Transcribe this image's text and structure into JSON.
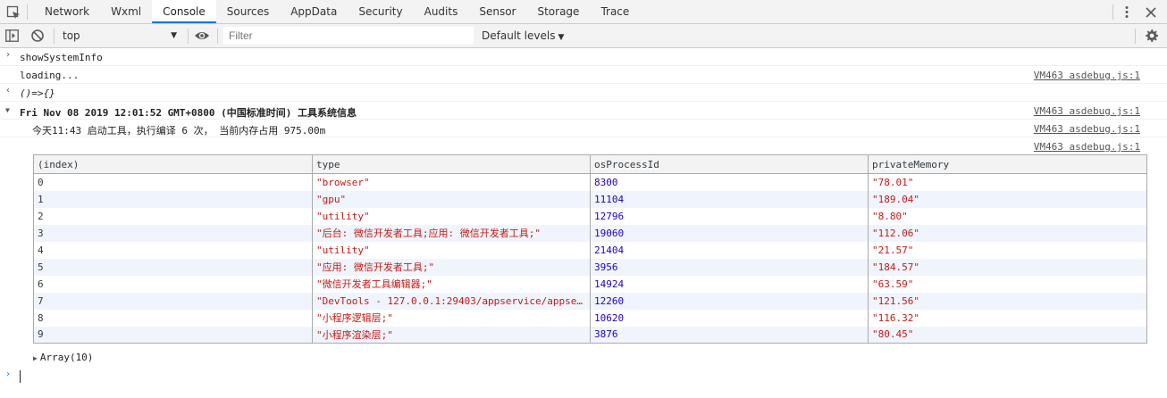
{
  "tabs": [
    {
      "label": "Network"
    },
    {
      "label": "Wxml"
    },
    {
      "label": "Console",
      "active": true
    },
    {
      "label": "Sources"
    },
    {
      "label": "AppData"
    },
    {
      "label": "Security"
    },
    {
      "label": "Audits"
    },
    {
      "label": "Sensor"
    },
    {
      "label": "Storage"
    },
    {
      "label": "Trace"
    }
  ],
  "toolbar": {
    "context": "top",
    "filter_placeholder": "Filter",
    "levels_label": "Default levels"
  },
  "console": {
    "lines": [
      {
        "prompt": ">",
        "text": "showSystemInfo",
        "source": ""
      },
      {
        "prompt": "",
        "text": "loading...",
        "source": "VM463 asdebug.js:1"
      },
      {
        "prompt": "<",
        "text": "()=>{}",
        "source": ""
      },
      {
        "prompt": "▼",
        "text": "Fri Nov 08 2019 12:01:52 GMT+0800 (中国标准时间) 工具系统信息",
        "source": "VM463 asdebug.js:1"
      },
      {
        "prompt": "",
        "text": "今天11:43 启动工具，执行编译 6 次， 当前内存占用 975.00m",
        "source": "VM463 asdebug.js:1"
      },
      {
        "prompt": "",
        "text": "",
        "source": "VM463 asdebug.js:1"
      }
    ],
    "table": {
      "headers": [
        "(index)",
        "type",
        "osProcessId",
        "privateMemory"
      ],
      "rows": [
        [
          "0",
          "\"browser\"",
          "8300",
          "\"78.01\""
        ],
        [
          "1",
          "\"gpu\"",
          "11104",
          "\"189.04\""
        ],
        [
          "2",
          "\"utility\"",
          "12796",
          "\"8.80\""
        ],
        [
          "3",
          "\"后台: 微信开发者工具;应用: 微信开发者工具;\"",
          "19060",
          "\"112.06\""
        ],
        [
          "4",
          "\"utility\"",
          "21404",
          "\"21.57\""
        ],
        [
          "5",
          "\"应用: 微信开发者工具;\"",
          "3956",
          "\"184.57\""
        ],
        [
          "6",
          "\"微信开发者工具编辑器;\"",
          "14924",
          "\"63.59\""
        ],
        [
          "7",
          "\"DevTools - 127.0.0.1:29403/appservice/appservice\"",
          "12260",
          "\"121.56\""
        ],
        [
          "8",
          "\"小程序逻辑层;\"",
          "10620",
          "\"116.32\""
        ],
        [
          "9",
          "\"小程序渲染层;\"",
          "3876",
          "\"80.45\""
        ]
      ]
    },
    "array_label": "Array(10)",
    "input_prompt": ">"
  }
}
